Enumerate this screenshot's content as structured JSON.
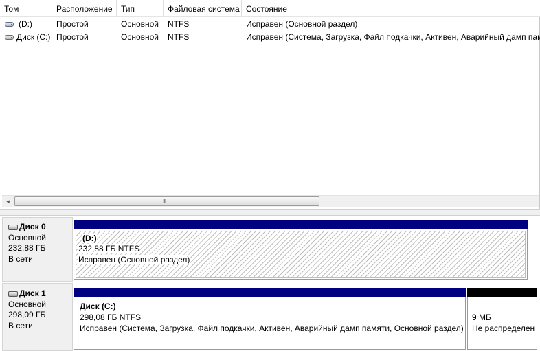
{
  "columns": {
    "volume": "Том",
    "layout": "Расположение",
    "type": "Тип",
    "filesystem": "Файловая система",
    "status": "Состояние"
  },
  "rows": [
    {
      "volume": "(D:)",
      "layout": "Простой",
      "type": "Основной",
      "filesystem": "NTFS",
      "status": "Исправен (Основной раздел)",
      "icon": "volume-icon"
    },
    {
      "volume": "Диск (C:)",
      "layout": "Простой",
      "type": "Основной",
      "filesystem": "NTFS",
      "status": "Исправен (Система, Загрузка, Файл подкачки, Активен, Аварийный дамп памя",
      "icon": "volume-icon"
    }
  ],
  "scrollbar": {
    "left_arrow": "◂",
    "grip": "III"
  },
  "disks": [
    {
      "title": "Диск 0",
      "kind": "Основной",
      "size": "232,88 ГБ",
      "state": "В сети",
      "partitions": [
        {
          "name": "(D:)",
          "fs": "232,88 ГБ NTFS",
          "status": "Исправен (Основной раздел)",
          "bar_color": "#000080",
          "selected": true
        }
      ]
    },
    {
      "title": "Диск 1",
      "kind": "Основной",
      "size": "298,09 ГБ",
      "state": "В сети",
      "partitions": [
        {
          "name": "Диск  (C:)",
          "fs": "298,08 ГБ NTFS",
          "status": "Исправен (Система, Загрузка, Файл подкачки, Активен, Аварийный дамп памяти, Основной раздел)",
          "bar_color": "#000080"
        },
        {
          "name": "",
          "fs": "9 МБ",
          "status": "Не распределен",
          "bar_color": "#000000"
        }
      ]
    }
  ]
}
